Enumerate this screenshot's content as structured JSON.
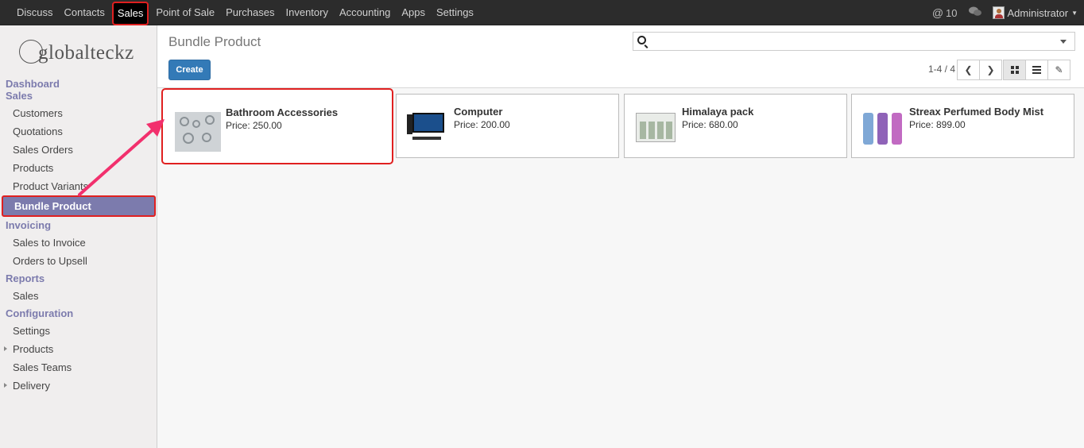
{
  "topbar": {
    "menu": [
      "Discuss",
      "Contacts",
      "Sales",
      "Point of Sale",
      "Purchases",
      "Inventory",
      "Accounting",
      "Apps",
      "Settings"
    ],
    "active": "Sales",
    "messages_count": "10",
    "user": "Administrator"
  },
  "sidebar": {
    "logo": "globalteckz",
    "sections": {
      "dashboard": "Dashboard",
      "sales": "Sales",
      "sales_items": [
        "Customers",
        "Quotations",
        "Sales Orders",
        "Products",
        "Product Variants",
        "Bundle Product"
      ],
      "invoicing": "Invoicing",
      "invoicing_items": [
        "Sales to Invoice",
        "Orders to Upsell"
      ],
      "reports": "Reports",
      "reports_items": [
        "Sales"
      ],
      "configuration": "Configuration",
      "configuration_items": [
        "Settings",
        "Products",
        "Sales Teams",
        "Delivery"
      ]
    },
    "active_item": "Bundle Product"
  },
  "control": {
    "title": "Bundle Product",
    "create_label": "Create",
    "search_placeholder": "",
    "pager": "1-4 / 4"
  },
  "products": [
    {
      "name": "Bathroom Accessories",
      "price": "Price: 250.00",
      "image": "bathroom-accessories-image"
    },
    {
      "name": "Computer",
      "price": "Price: 200.00",
      "image": "computer-image"
    },
    {
      "name": "Himalaya pack",
      "price": "Price: 680.00",
      "image": "himalaya-pack-image"
    },
    {
      "name": "Streax Perfumed Body Mist",
      "price": "Price: 899.00",
      "image": "body-mist-image"
    }
  ],
  "colors": {
    "topbar": "#2c2c2c",
    "accent": "#7c7bad",
    "primary": "#337ab7",
    "highlight": "#e02020",
    "arrow": "#f2306d"
  }
}
